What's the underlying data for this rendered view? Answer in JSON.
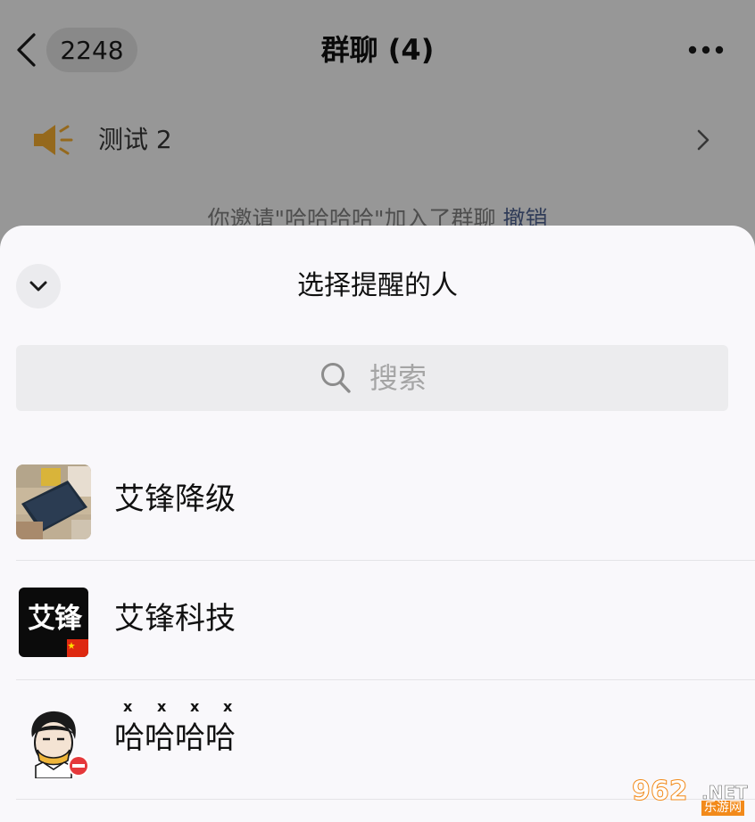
{
  "chat": {
    "unread_count": "2248",
    "title": "群聊 (4)",
    "notice_text": "测试 2",
    "system_message": {
      "prefix": "你邀请\"",
      "name": "哈哈哈哈",
      "suffix": "\"加入了群聊",
      "undo_label": "撤销"
    }
  },
  "sheet": {
    "title": "选择提醒的人",
    "search_placeholder": "搜索"
  },
  "members": [
    {
      "name": "艾锋降级"
    },
    {
      "name": "艾锋科技",
      "avatar_text": "艾锋"
    },
    {
      "name": "哈哈哈哈",
      "pinyin_marks": [
        "x",
        "x",
        "x",
        "x"
      ]
    }
  ],
  "watermark": {
    "main": "962",
    "suffix": ".NET",
    "sub": "乐游网"
  },
  "colors": {
    "accent_link": "#4c5f8a",
    "speaker": "#e9a52e",
    "sheet_bg": "#f9f8fb",
    "badge_red": "#e5383b"
  }
}
